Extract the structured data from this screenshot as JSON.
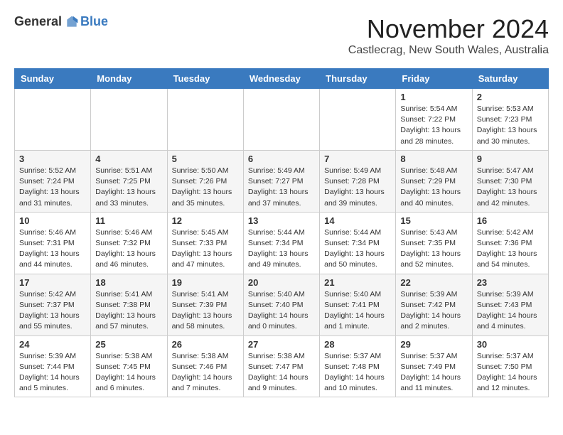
{
  "header": {
    "logo_general": "General",
    "logo_blue": "Blue",
    "month_title": "November 2024",
    "location": "Castlecrag, New South Wales, Australia"
  },
  "days_of_week": [
    "Sunday",
    "Monday",
    "Tuesday",
    "Wednesday",
    "Thursday",
    "Friday",
    "Saturday"
  ],
  "weeks": [
    [
      {
        "day": "",
        "info": ""
      },
      {
        "day": "",
        "info": ""
      },
      {
        "day": "",
        "info": ""
      },
      {
        "day": "",
        "info": ""
      },
      {
        "day": "",
        "info": ""
      },
      {
        "day": "1",
        "info": "Sunrise: 5:54 AM\nSunset: 7:22 PM\nDaylight: 13 hours and 28 minutes."
      },
      {
        "day": "2",
        "info": "Sunrise: 5:53 AM\nSunset: 7:23 PM\nDaylight: 13 hours and 30 minutes."
      }
    ],
    [
      {
        "day": "3",
        "info": "Sunrise: 5:52 AM\nSunset: 7:24 PM\nDaylight: 13 hours and 31 minutes."
      },
      {
        "day": "4",
        "info": "Sunrise: 5:51 AM\nSunset: 7:25 PM\nDaylight: 13 hours and 33 minutes."
      },
      {
        "day": "5",
        "info": "Sunrise: 5:50 AM\nSunset: 7:26 PM\nDaylight: 13 hours and 35 minutes."
      },
      {
        "day": "6",
        "info": "Sunrise: 5:49 AM\nSunset: 7:27 PM\nDaylight: 13 hours and 37 minutes."
      },
      {
        "day": "7",
        "info": "Sunrise: 5:49 AM\nSunset: 7:28 PM\nDaylight: 13 hours and 39 minutes."
      },
      {
        "day": "8",
        "info": "Sunrise: 5:48 AM\nSunset: 7:29 PM\nDaylight: 13 hours and 40 minutes."
      },
      {
        "day": "9",
        "info": "Sunrise: 5:47 AM\nSunset: 7:30 PM\nDaylight: 13 hours and 42 minutes."
      }
    ],
    [
      {
        "day": "10",
        "info": "Sunrise: 5:46 AM\nSunset: 7:31 PM\nDaylight: 13 hours and 44 minutes."
      },
      {
        "day": "11",
        "info": "Sunrise: 5:46 AM\nSunset: 7:32 PM\nDaylight: 13 hours and 46 minutes."
      },
      {
        "day": "12",
        "info": "Sunrise: 5:45 AM\nSunset: 7:33 PM\nDaylight: 13 hours and 47 minutes."
      },
      {
        "day": "13",
        "info": "Sunrise: 5:44 AM\nSunset: 7:34 PM\nDaylight: 13 hours and 49 minutes."
      },
      {
        "day": "14",
        "info": "Sunrise: 5:44 AM\nSunset: 7:34 PM\nDaylight: 13 hours and 50 minutes."
      },
      {
        "day": "15",
        "info": "Sunrise: 5:43 AM\nSunset: 7:35 PM\nDaylight: 13 hours and 52 minutes."
      },
      {
        "day": "16",
        "info": "Sunrise: 5:42 AM\nSunset: 7:36 PM\nDaylight: 13 hours and 54 minutes."
      }
    ],
    [
      {
        "day": "17",
        "info": "Sunrise: 5:42 AM\nSunset: 7:37 PM\nDaylight: 13 hours and 55 minutes."
      },
      {
        "day": "18",
        "info": "Sunrise: 5:41 AM\nSunset: 7:38 PM\nDaylight: 13 hours and 57 minutes."
      },
      {
        "day": "19",
        "info": "Sunrise: 5:41 AM\nSunset: 7:39 PM\nDaylight: 13 hours and 58 minutes."
      },
      {
        "day": "20",
        "info": "Sunrise: 5:40 AM\nSunset: 7:40 PM\nDaylight: 14 hours and 0 minutes."
      },
      {
        "day": "21",
        "info": "Sunrise: 5:40 AM\nSunset: 7:41 PM\nDaylight: 14 hours and 1 minute."
      },
      {
        "day": "22",
        "info": "Sunrise: 5:39 AM\nSunset: 7:42 PM\nDaylight: 14 hours and 2 minutes."
      },
      {
        "day": "23",
        "info": "Sunrise: 5:39 AM\nSunset: 7:43 PM\nDaylight: 14 hours and 4 minutes."
      }
    ],
    [
      {
        "day": "24",
        "info": "Sunrise: 5:39 AM\nSunset: 7:44 PM\nDaylight: 14 hours and 5 minutes."
      },
      {
        "day": "25",
        "info": "Sunrise: 5:38 AM\nSunset: 7:45 PM\nDaylight: 14 hours and 6 minutes."
      },
      {
        "day": "26",
        "info": "Sunrise: 5:38 AM\nSunset: 7:46 PM\nDaylight: 14 hours and 7 minutes."
      },
      {
        "day": "27",
        "info": "Sunrise: 5:38 AM\nSunset: 7:47 PM\nDaylight: 14 hours and 9 minutes."
      },
      {
        "day": "28",
        "info": "Sunrise: 5:37 AM\nSunset: 7:48 PM\nDaylight: 14 hours and 10 minutes."
      },
      {
        "day": "29",
        "info": "Sunrise: 5:37 AM\nSunset: 7:49 PM\nDaylight: 14 hours and 11 minutes."
      },
      {
        "day": "30",
        "info": "Sunrise: 5:37 AM\nSunset: 7:50 PM\nDaylight: 14 hours and 12 minutes."
      }
    ]
  ]
}
